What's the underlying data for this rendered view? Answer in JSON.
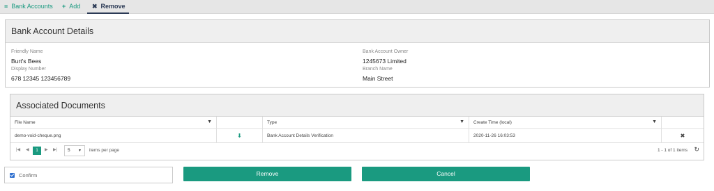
{
  "nav": {
    "bank_accounts": "Bank Accounts",
    "add": "Add",
    "remove": "Remove",
    "icons": {
      "bank_accounts": "list-icon",
      "add": "plus-icon",
      "remove": "x-icon"
    }
  },
  "details": {
    "title": "Bank Account Details",
    "friendly_name_label": "Friendly Name",
    "friendly_name": "Burt's Bees",
    "display_number_label": "Display Number",
    "display_number": "678 12345 123456789",
    "owner_label": "Bank Account Owner",
    "owner": "1245673 Limited",
    "branch_label": "Branch Name",
    "branch": "Main Street"
  },
  "documents": {
    "title": "Associated Documents",
    "columns": [
      "File Name",
      "",
      "Type",
      "Create Time (local)",
      ""
    ],
    "rows": [
      {
        "file_name": "demo-void-cheque.png",
        "type": "Bank Account Details Verification",
        "create_time": "2020-11-26 16:03:53"
      }
    ],
    "pager": {
      "current_page": "1",
      "page_size": "5",
      "items_per_page_label": "items per page",
      "info": "1 - 1 of 1 items"
    }
  },
  "actions": {
    "confirm_label": "Confirm",
    "confirm_checked": true,
    "remove_label": "Remove",
    "cancel_label": "Cancel"
  },
  "colors": {
    "accent": "#1a9a80",
    "active_nav": "#2b3a55",
    "checkbox": "#2e6fcf"
  }
}
